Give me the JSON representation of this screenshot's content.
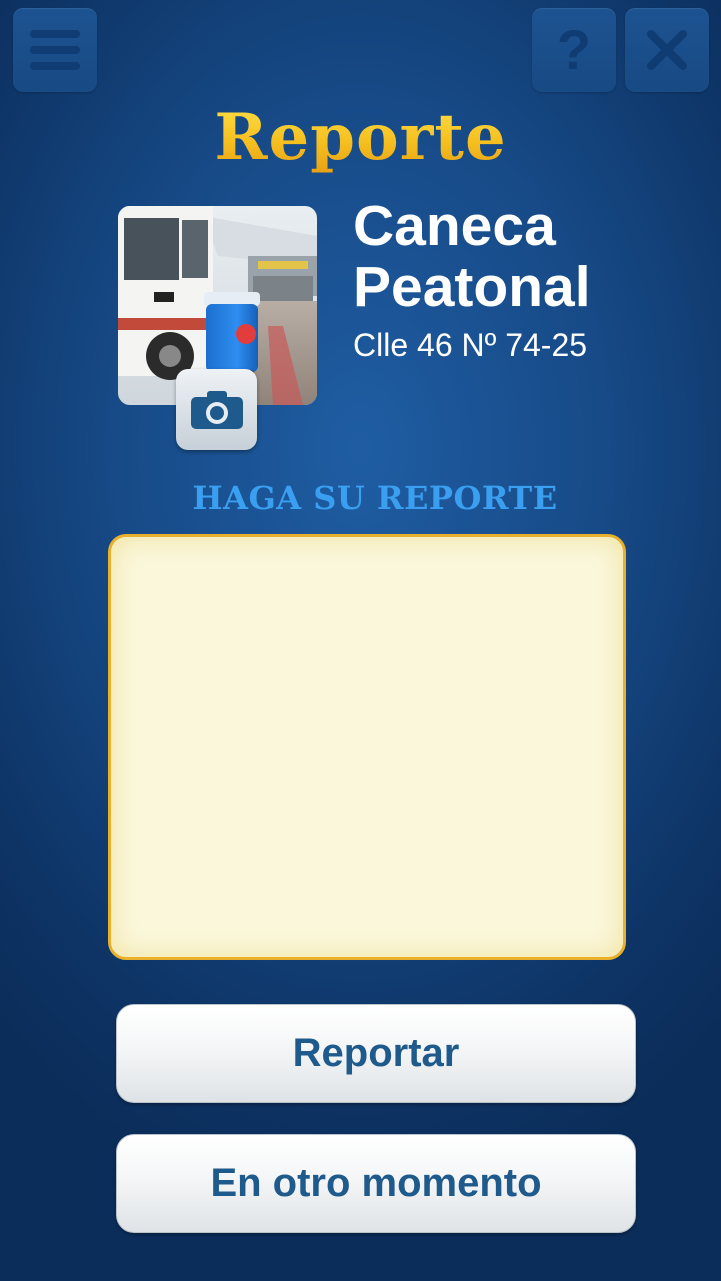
{
  "header": {
    "title": "Reporte",
    "menu_icon": "hamburger-menu-icon",
    "help_icon": "question-mark-icon",
    "close_icon": "close-x-icon"
  },
  "item": {
    "name_line1": "Caneca",
    "name_line2": "Peatonal",
    "address": "Clle 46 Nº 74-25",
    "photo_icon": "camera-icon"
  },
  "report": {
    "prompt": "HAGA SU REPORTE",
    "text_value": "",
    "placeholder": ""
  },
  "actions": {
    "submit_label": "Reportar",
    "later_label": "En otro momento"
  },
  "colors": {
    "background": "#174a87",
    "title_gold": "#f6c020",
    "prompt_blue": "#3a9ff0",
    "box_border": "#e8b02c",
    "box_fill": "#faf7db",
    "button_text": "#1f5a8c"
  }
}
